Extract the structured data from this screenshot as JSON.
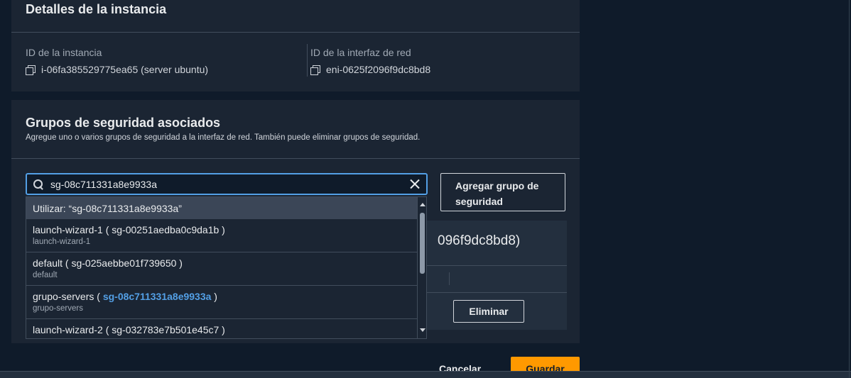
{
  "instance_details": {
    "title": "Detalles de la instancia",
    "instance_id_label": "ID de la instancia",
    "instance_id_value": "i-06fa385529775ea65 (server ubuntu)",
    "eni_label": "ID de la interfaz de red",
    "eni_value": "eni-0625f2096f9dc8bd8"
  },
  "security_groups": {
    "title": "Grupos de seguridad asociados",
    "description": "Agregue uno o varios grupos de seguridad a la interfaz de red. También puede eliminar grupos de seguridad.",
    "search_value": "sg-08c711331a8e9933a",
    "add_button": "Agregar grupo de seguridad",
    "interface_partial_text": "096f9dc8bd8)",
    "remove_button": "Eliminar"
  },
  "dropdown": {
    "use_option": "Utilizar: “sg-08c711331a8e9933a”",
    "items": [
      {
        "name": "launch-wizard-1 ( sg-00251aedba0c9da1b )",
        "sub": "launch-wizard-1"
      },
      {
        "name": "default ( sg-025aebbe01f739650 )",
        "sub": "default"
      },
      {
        "name_prefix": "grupo-servers ( ",
        "name_match": "sg-08c711331a8e9933a",
        "name_suffix": " )",
        "sub": "grupo-servers"
      },
      {
        "name": "launch-wizard-2 ( sg-032783e7b501e45c7 )",
        "sub": ""
      }
    ]
  },
  "footer": {
    "cancel": "Cancelar",
    "save": "Guardar"
  },
  "colors": {
    "background": "#0f1b2a",
    "card": "#1b2533",
    "focus": "#539fe5",
    "primary": "#ff9900"
  }
}
